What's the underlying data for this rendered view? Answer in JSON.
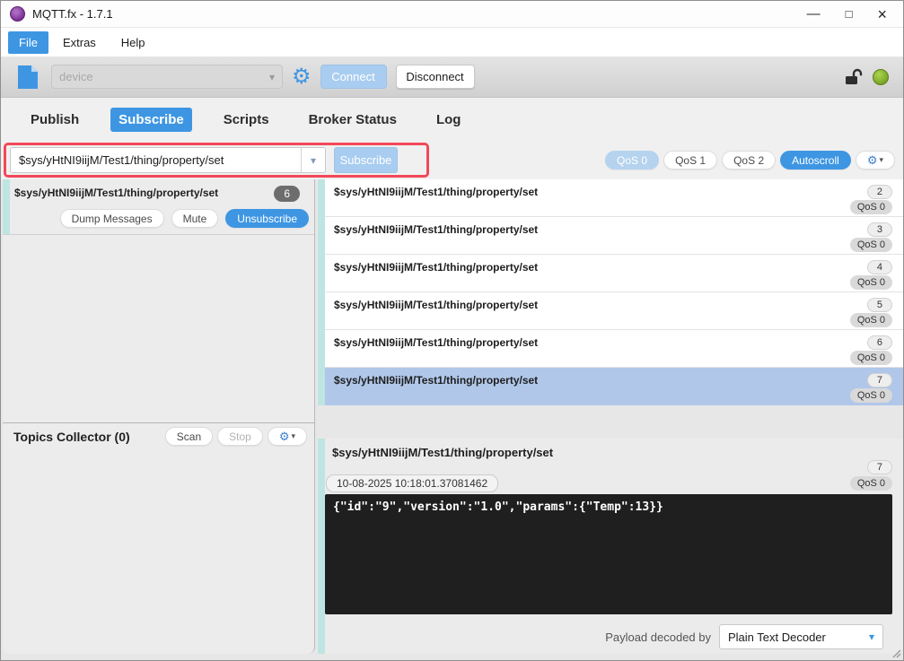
{
  "window": {
    "title": "MQTT.fx - 1.7.1"
  },
  "menu": {
    "file": "File",
    "extras": "Extras",
    "help": "Help"
  },
  "toolbar": {
    "profile_placeholder": "device",
    "connect": "Connect",
    "disconnect": "Disconnect"
  },
  "tabs": {
    "publish": "Publish",
    "subscribe": "Subscribe",
    "scripts": "Scripts",
    "broker_status": "Broker Status",
    "log": "Log"
  },
  "subscribe_bar": {
    "topic": "$sys/yHtNI9iijM/Test1/thing/property/set",
    "subscribe": "Subscribe",
    "qos0": "QoS 0",
    "qos1": "QoS 1",
    "qos2": "QoS 2",
    "autoscroll": "Autoscroll"
  },
  "left_panel": {
    "subscription": {
      "topic": "$sys/yHtNI9iijM/Test1/thing/property/set",
      "count": "6",
      "dump": "Dump Messages",
      "mute": "Mute",
      "unsubscribe": "Unsubscribe"
    },
    "collector": {
      "title": "Topics Collector (0)",
      "scan": "Scan",
      "stop": "Stop"
    }
  },
  "messages": [
    {
      "topic": "$sys/yHtNI9iijM/Test1/thing/property/set",
      "seq": "2",
      "qos": "QoS 0",
      "selected": false
    },
    {
      "topic": "$sys/yHtNI9iijM/Test1/thing/property/set",
      "seq": "3",
      "qos": "QoS 0",
      "selected": false
    },
    {
      "topic": "$sys/yHtNI9iijM/Test1/thing/property/set",
      "seq": "4",
      "qos": "QoS 0",
      "selected": false
    },
    {
      "topic": "$sys/yHtNI9iijM/Test1/thing/property/set",
      "seq": "5",
      "qos": "QoS 0",
      "selected": false
    },
    {
      "topic": "$sys/yHtNI9iijM/Test1/thing/property/set",
      "seq": "6",
      "qos": "QoS 0",
      "selected": false
    },
    {
      "topic": "$sys/yHtNI9iijM/Test1/thing/property/set",
      "seq": "7",
      "qos": "QoS 0",
      "selected": true
    }
  ],
  "detail": {
    "topic": "$sys/yHtNI9iijM/Test1/thing/property/set",
    "seq": "7",
    "qos": "QoS 0",
    "timestamp": "10-08-2025 10:18:01.37081462",
    "payload": "{\"id\":\"9\",\"version\":\"1.0\",\"params\":{\"Temp\":13}}",
    "decoder_label": "Payload decoded by",
    "decoder": "Plain Text Decoder"
  },
  "icons": {
    "gear": "⚙",
    "chevron_down": "▾",
    "minimize": "—",
    "maximize": "□",
    "close": "×"
  },
  "colors": {
    "accent_blue": "#3e96e3",
    "accent_blue_light": "#aecff0",
    "teal_accent": "#bfe5e2",
    "selected_row": "#b0c7e9",
    "annotation_red": "#f2485a",
    "status_green": "#76a226",
    "payload_background": "#1f1f1f"
  }
}
